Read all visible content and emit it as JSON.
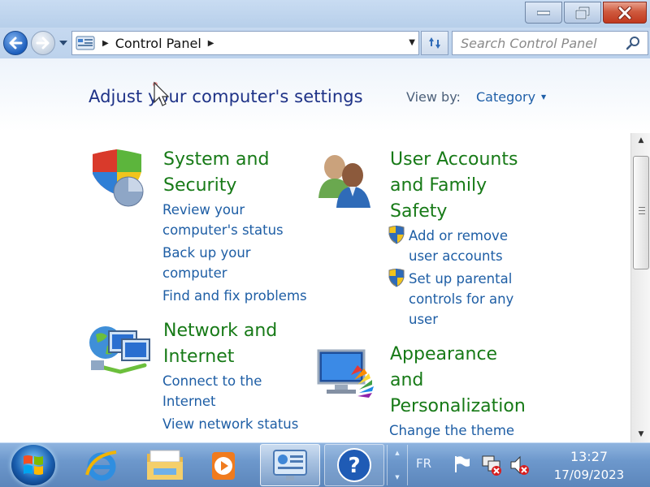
{
  "window": {
    "controls": [
      "minimize",
      "restore",
      "close"
    ]
  },
  "address_bar": {
    "location_icon": "control-panel-icon",
    "breadcrumb": [
      "Control Panel"
    ],
    "search_placeholder": "Search Control Panel"
  },
  "header": {
    "title": "Adjust your computer's settings",
    "view_by_label": "View by:",
    "view_by_value": "Category"
  },
  "categories": [
    {
      "title_lines": [
        "System and",
        "Security"
      ],
      "icon": "shield-pie-icon",
      "links": [
        {
          "lines": [
            "Review your",
            "computer's status"
          ],
          "shield": false
        },
        {
          "lines": [
            "Back up your",
            "computer"
          ],
          "shield": false
        },
        {
          "lines": [
            "Find and fix problems"
          ],
          "shield": false
        }
      ]
    },
    {
      "title_lines": [
        "User Accounts",
        "and Family",
        "Safety"
      ],
      "icon": "users-icon",
      "links": [
        {
          "lines": [
            "Add or remove",
            "user accounts"
          ],
          "shield": true
        },
        {
          "lines": [
            "Set up parental",
            "controls for any",
            "user"
          ],
          "shield": true
        }
      ]
    },
    {
      "title_lines": [
        "Network and",
        "Internet"
      ],
      "icon": "network-globe-icon",
      "links": [
        {
          "lines": [
            "Connect to the",
            "Internet"
          ],
          "shield": false
        },
        {
          "lines": [
            "View network status"
          ],
          "shield": false
        }
      ]
    },
    {
      "title_lines": [
        "Appearance",
        "and",
        "Personalization"
      ],
      "icon": "monitor-palette-icon",
      "links": [
        {
          "lines": [
            "Change the theme"
          ],
          "shield": false
        }
      ]
    }
  ],
  "taskbar": {
    "apps": [
      "internet-explorer-icon",
      "explorer-folder-icon",
      "media-player-icon",
      "control-panel-icon",
      "help-icon"
    ],
    "language": "FR",
    "time": "13:27",
    "date": "17/09/2023"
  },
  "colors": {
    "title_blue": "#1e3287",
    "category_green": "#177a17",
    "link_blue": "#1e5ea5"
  }
}
